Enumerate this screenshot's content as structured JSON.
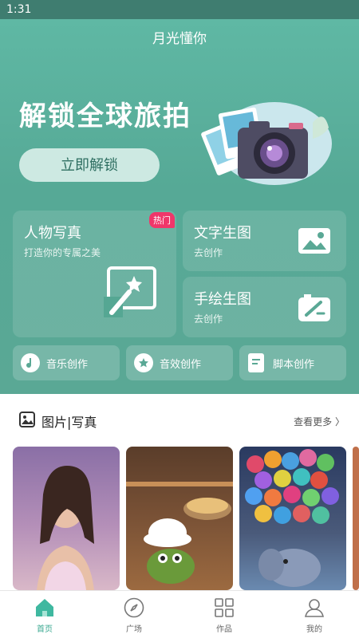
{
  "status": {
    "time": "1:31"
  },
  "header": {
    "title": "月光懂你"
  },
  "banner": {
    "title": "解锁全球旅拍",
    "button": "立即解锁"
  },
  "cards": {
    "portrait": {
      "title": "人物写真",
      "subtitle": "打造你的专属之美",
      "badge": "热门"
    },
    "text_to_image": {
      "title": "文字生图",
      "subtitle": "去创作"
    },
    "sketch_to_image": {
      "title": "手绘生图",
      "subtitle": "去创作"
    }
  },
  "pills": {
    "music": "音乐创作",
    "sound": "音效创作",
    "script": "脚本创作"
  },
  "section": {
    "title": "图片|写真",
    "more": "查看更多 〉"
  },
  "tabs": {
    "home": "首页",
    "plaza": "广场",
    "works": "作品",
    "mine": "我的"
  },
  "colors": {
    "accent": "#3aa890",
    "hero": "#5fb8a4",
    "badge": "#f0366a"
  }
}
